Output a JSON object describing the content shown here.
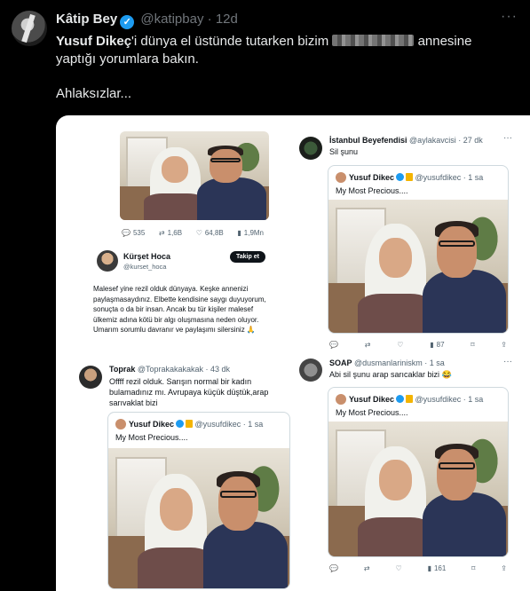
{
  "tweet": {
    "author_name": "Kâtip Bey",
    "handle": "@katipbay",
    "separator": "·",
    "time": "12d",
    "more": "···",
    "text_bold": "Yusuf Dikeç",
    "text_part1": "'i dünya el üstünde tutarken bizim",
    "text_part2": "annesine",
    "text_line2": "yaptığı yorumlara bakın.",
    "text_line3": "Ahlaksızlar..."
  },
  "panel_a": {
    "actions": [
      "535",
      "1,6B",
      "64,8B",
      "1,9Mn"
    ],
    "name": "Kürşet Hoca",
    "handle": "@kurset_hoca",
    "follow_label": "Takip et",
    "text": "Malesef yine rezil olduk dünyaya. Keşke annenizi paylaşmasaydınız. Elbette kendisine saygı duyuyorum, sonuçta o da bir insan. Ancak bu tür kişiler malesef ülkemiz adına kötü bir algı oluşmasına neden oluyor. Umarım sorumlu davranır ve paylaşımı silersiniz 🙏"
  },
  "panel_b": {
    "name": "İstanbul Beyefendisi",
    "handle": "@aylakavcisi",
    "time": "· 27 dk",
    "text": "Sil şunu",
    "quote_name": "Yusuf Dikec",
    "quote_handle": "@yusufdikec · 1 sa",
    "quote_text": "My Most Precious....",
    "views": "87"
  },
  "panel_c": {
    "name": "Toprak",
    "handle": "@Toprakakakakak",
    "time": "· 43 dk",
    "text": "Offff rezil olduk. Sarışın normal bir kadın bulamadınız mı. Avrupaya küçük düştük,arap sarıvaklat bizi",
    "quote_name": "Yusuf Dikec",
    "quote_handle": "@yusufdikec · 1 sa",
    "quote_text": "My Most Precious...."
  },
  "panel_d": {
    "name": "SOAP",
    "handle": "@dusmanlariniskm",
    "time": "· 1 sa",
    "text": "Abi sil şunu arap sarıcaklar bizi 😂",
    "quote_name": "Yusuf Dikec",
    "quote_handle": "@yusufdikec · 1 sa",
    "quote_text": "My Most Precious....",
    "views": "161"
  }
}
